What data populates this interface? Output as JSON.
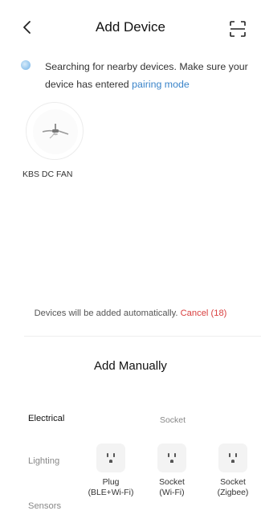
{
  "header": {
    "title": "Add Device",
    "back_icon": "chevron-left-icon",
    "scan_icon": "scan-frame-icon"
  },
  "search": {
    "status_text": "Searching for nearby devices. Make sure your device has entered ",
    "link_text": "pairing mode",
    "link_color": "#3a84c9"
  },
  "found_devices": [
    {
      "name": "KBS DC FAN",
      "icon": "ceiling-fan-icon"
    }
  ],
  "auto_add": {
    "text": "Devices will be added automatically.",
    "cancel_label": "Cancel (18)",
    "cancel_color": "#d94040"
  },
  "manual": {
    "title": "Add Manually",
    "categories": [
      {
        "label": "Electrical",
        "active": true
      },
      {
        "label": "Lighting",
        "active": false
      },
      {
        "label": "Sensors",
        "active": false
      }
    ],
    "section_label": "Socket",
    "products": [
      {
        "line1": "Plug",
        "line2": "(BLE+Wi-Fi)",
        "icon": "socket-outlet-icon"
      },
      {
        "line1": "Socket",
        "line2": "(Wi-Fi)",
        "icon": "socket-outlet-icon"
      },
      {
        "line1": "Socket",
        "line2": "(Zigbee)",
        "icon": "socket-outlet-icon"
      }
    ]
  }
}
